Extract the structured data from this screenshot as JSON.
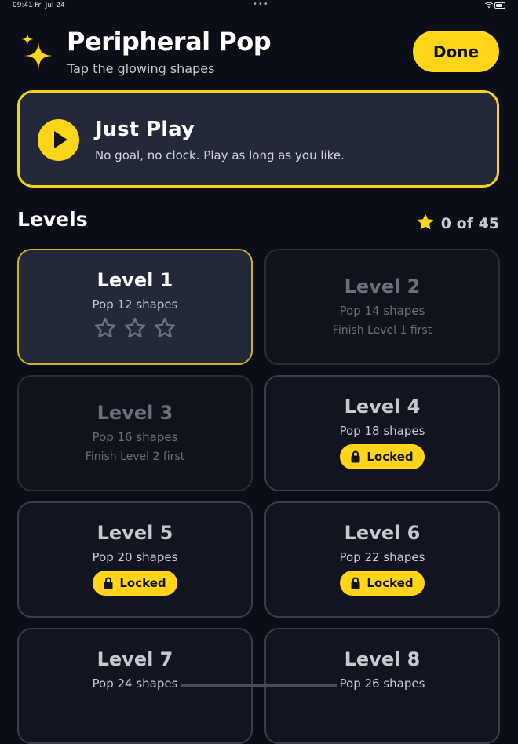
{
  "status": {
    "time": "09:41",
    "date": "Fri Jul 24",
    "dots": "•••"
  },
  "header": {
    "title": "Peripheral Pop",
    "subtitle": "Tap the glowing shapes",
    "done_label": "Done"
  },
  "just_play": {
    "title": "Just Play",
    "description": "No goal, no clock. Play as long as you like."
  },
  "levels": {
    "heading": "Levels",
    "stars_summary": "0 of 45",
    "items": [
      {
        "title": "Level 1",
        "shapes": "Pop 12 shapes",
        "stars_earned": 0,
        "stars_total": 3,
        "state": "current"
      },
      {
        "title": "Level 2",
        "shapes": "Pop 14 shapes",
        "note": "Finish Level 1 first",
        "state": "dim"
      },
      {
        "title": "Level 3",
        "shapes": "Pop 16 shapes",
        "note": "Finish Level 2 first",
        "state": "dim"
      },
      {
        "title": "Level 4",
        "shapes": "Pop 18 shapes",
        "badge": "Locked",
        "state": "locked"
      },
      {
        "title": "Level 5",
        "shapes": "Pop 20 shapes",
        "badge": "Locked",
        "state": "locked"
      },
      {
        "title": "Level 6",
        "shapes": "Pop 22 shapes",
        "badge": "Locked",
        "state": "locked"
      },
      {
        "title": "Level 7",
        "shapes": "Pop 24 shapes",
        "state": "locked"
      },
      {
        "title": "Level 8",
        "shapes": "Pop 26 shapes",
        "state": "locked"
      }
    ]
  },
  "colors": {
    "accent": "#ffd51a",
    "background": "#0c0e17",
    "card": "#23283a"
  }
}
